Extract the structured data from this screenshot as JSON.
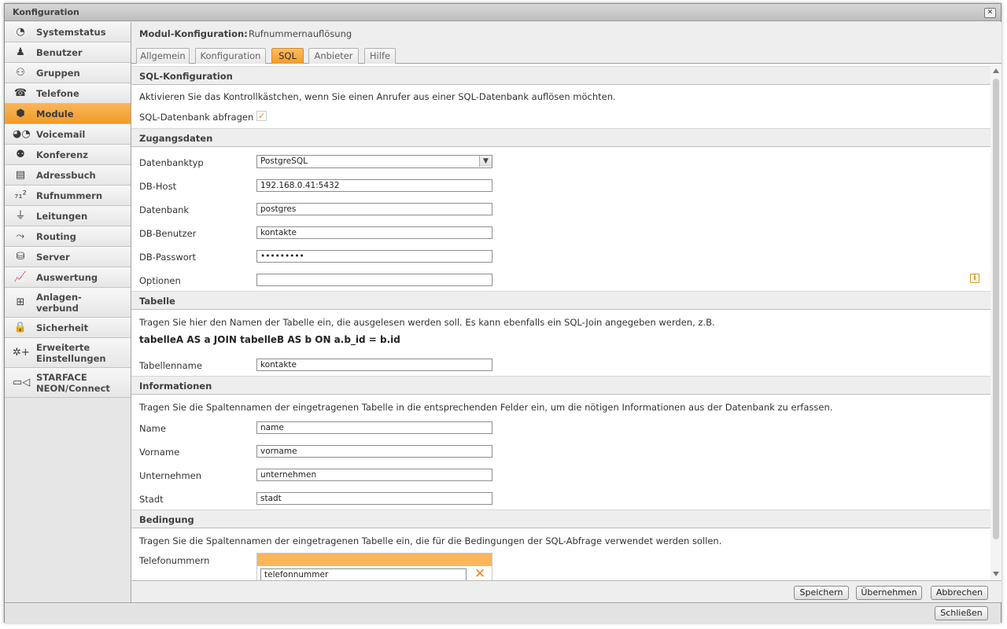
{
  "window": {
    "title": "Konfiguration",
    "close_glyph": "✕"
  },
  "sidebar": {
    "items": [
      {
        "label": "Systemstatus",
        "icon": "pie-chart-icon",
        "glyph": "◔"
      },
      {
        "label": "Benutzer",
        "icon": "user-icon",
        "glyph": "♟"
      },
      {
        "label": "Gruppen",
        "icon": "group-icon",
        "glyph": "⚇"
      },
      {
        "label": "Telefone",
        "icon": "phone-icon",
        "glyph": "☎"
      },
      {
        "label": "Module",
        "icon": "cube-icon",
        "glyph": "⬢",
        "active": true
      },
      {
        "label": "Voicemail",
        "icon": "voicemail-icon",
        "glyph": "◕◔"
      },
      {
        "label": "Konferenz",
        "icon": "conference-icon",
        "glyph": "⚉"
      },
      {
        "label": "Adressbuch",
        "icon": "addressbook-icon",
        "glyph": "▤"
      },
      {
        "label": "Rufnummern",
        "icon": "numbers-icon",
        "glyph": "₇₁²"
      },
      {
        "label": "Leitungen",
        "icon": "plug-icon",
        "glyph": "⏚"
      },
      {
        "label": "Routing",
        "icon": "routing-icon",
        "glyph": "⤳"
      },
      {
        "label": "Server",
        "icon": "server-icon",
        "glyph": "⛁"
      },
      {
        "label": "Auswertung",
        "icon": "chart-icon",
        "glyph": "📈"
      },
      {
        "label": "Anlagen-verbund",
        "icon": "network-icon",
        "glyph": "⊞"
      },
      {
        "label": "Sicherheit",
        "icon": "lock-icon",
        "glyph": "🔒"
      },
      {
        "label": "Erweiterte Einstellungen",
        "icon": "settings-plus-icon",
        "glyph": "✲+"
      },
      {
        "label": "STARFACE NEON/Connect",
        "icon": "video-icon",
        "glyph": "▭◁"
      }
    ]
  },
  "module_header": {
    "label": "Modul-Konfiguration:",
    "value": "Rufnummernauflösung"
  },
  "tabs": [
    {
      "label": "Allgemein"
    },
    {
      "label": "Konfiguration"
    },
    {
      "label": "SQL",
      "active": true
    },
    {
      "label": "Anbieter"
    },
    {
      "label": "Hilfe"
    }
  ],
  "sql_config": {
    "heading": "SQL-Konfiguration",
    "description": "Aktivieren Sie das Kontrollkästchen, wenn Sie einen Anrufer aus einer SQL-Datenbank auflösen möchten.",
    "checkbox_label": "SQL-Datenbank abfragen",
    "checkbox_checked": true,
    "check_glyph": "✓"
  },
  "access": {
    "heading": "Zugangsdaten",
    "db_type_label": "Datenbanktyp",
    "db_type_value": "PostgreSQL",
    "db_host_label": "DB-Host",
    "db_host_value": "192.168.0.41:5432",
    "database_label": "Datenbank",
    "database_value": "postgres",
    "db_user_label": "DB-Benutzer",
    "db_user_value": "kontakte",
    "db_password_label": "DB-Passwort",
    "db_password_value": "•••••••••",
    "options_label": "Optionen",
    "options_value": "",
    "info_glyph": "i"
  },
  "table": {
    "heading": "Tabelle",
    "description": "Tragen Sie hier den Namen der Tabelle ein, die ausgelesen werden soll. Es kann ebenfalls ein SQL-Join angegeben werden, z.B.",
    "example": "tabelleA AS a JOIN tabelleB AS b ON a.b_id = b.id",
    "name_label": "Tabellenname",
    "name_value": "kontakte"
  },
  "information": {
    "heading": "Informationen",
    "description": "Tragen Sie die Spaltennamen der eingetragenen Tabelle in die entsprechenden Felder ein, um die nötigen Informationen aus der Datenbank zu erfassen.",
    "name_label": "Name",
    "name_value": "name",
    "firstname_label": "Vorname",
    "firstname_value": "vorname",
    "company_label": "Unternehmen",
    "company_value": "unternehmen",
    "city_label": "Stadt",
    "city_value": "stadt"
  },
  "condition": {
    "heading": "Bedingung",
    "description": "Tragen Sie die Spaltennamen der eingetragenen Tabelle ein, die für die Bedingungen der SQL-Abfrage verwendet werden sollen.",
    "phone_label": "Telefonummern",
    "phone_value": "telefonnummer",
    "remove_glyph": "✕"
  },
  "footer": {
    "save": "Speichern",
    "apply": "Übernehmen",
    "cancel": "Abbrechen"
  },
  "statusbar": {
    "close": "Schließen"
  },
  "colors": {
    "accent": "#f29a26",
    "accent_light": "#fbb55a"
  }
}
